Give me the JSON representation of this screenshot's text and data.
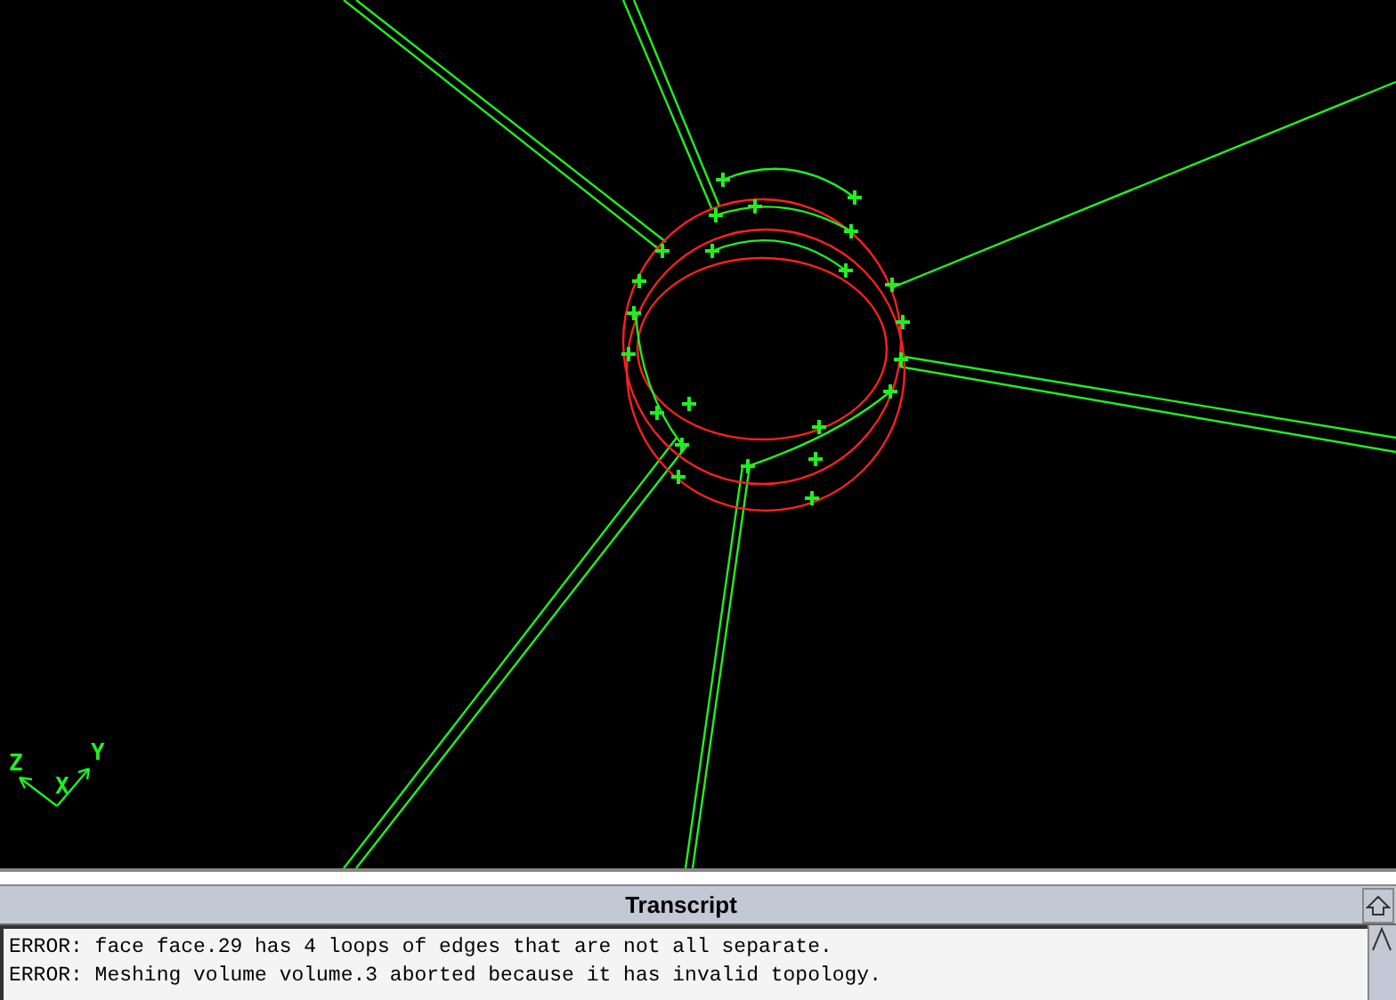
{
  "viewport": {
    "axes": [
      "Z",
      "Y",
      "X"
    ]
  },
  "transcript": {
    "title": "Transcript",
    "lines": [
      "ERROR: face face.29 has 4 loops of edges that are not all separate.",
      "ERROR: Meshing volume volume.3 aborted because it has invalid topology."
    ]
  }
}
